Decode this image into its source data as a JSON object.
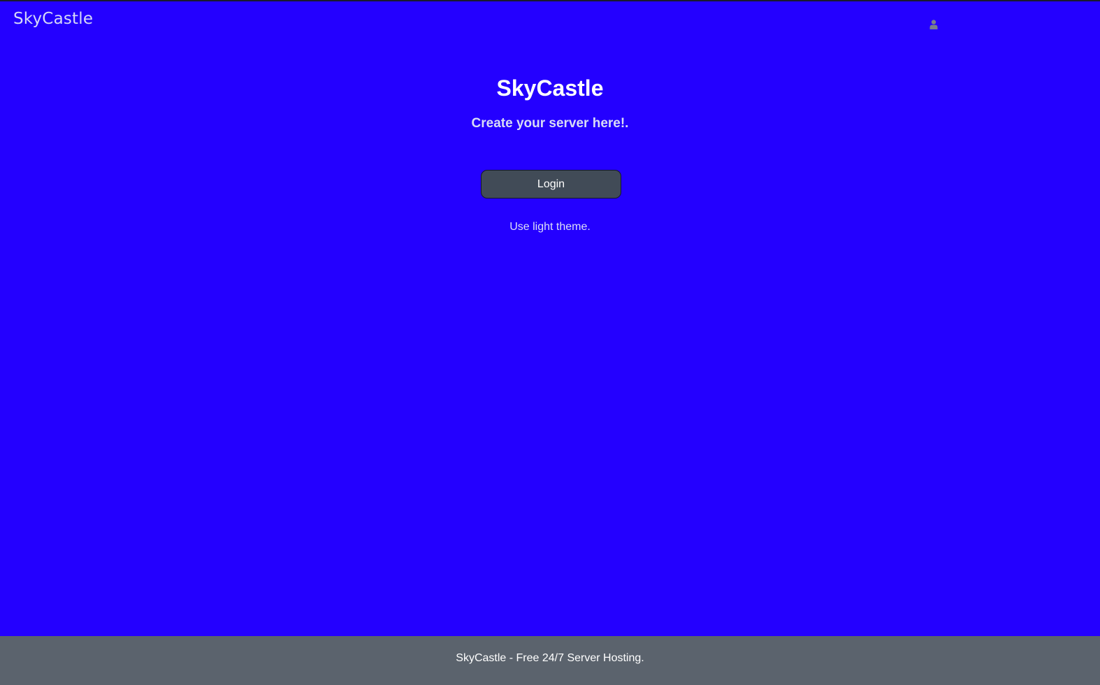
{
  "navbar": {
    "brand": "SkyCastle",
    "user_icon": "user-icon"
  },
  "hero": {
    "title": "SkyCastle",
    "subtitle": "Create your server here!."
  },
  "actions": {
    "login_label": "Login",
    "theme_toggle_label": "Use light theme."
  },
  "footer": {
    "text": "SkyCastle - Free 24/7 Server Hosting."
  },
  "colors": {
    "background": "#2400ff",
    "button": "#414b57",
    "footer": "#5b636d"
  }
}
